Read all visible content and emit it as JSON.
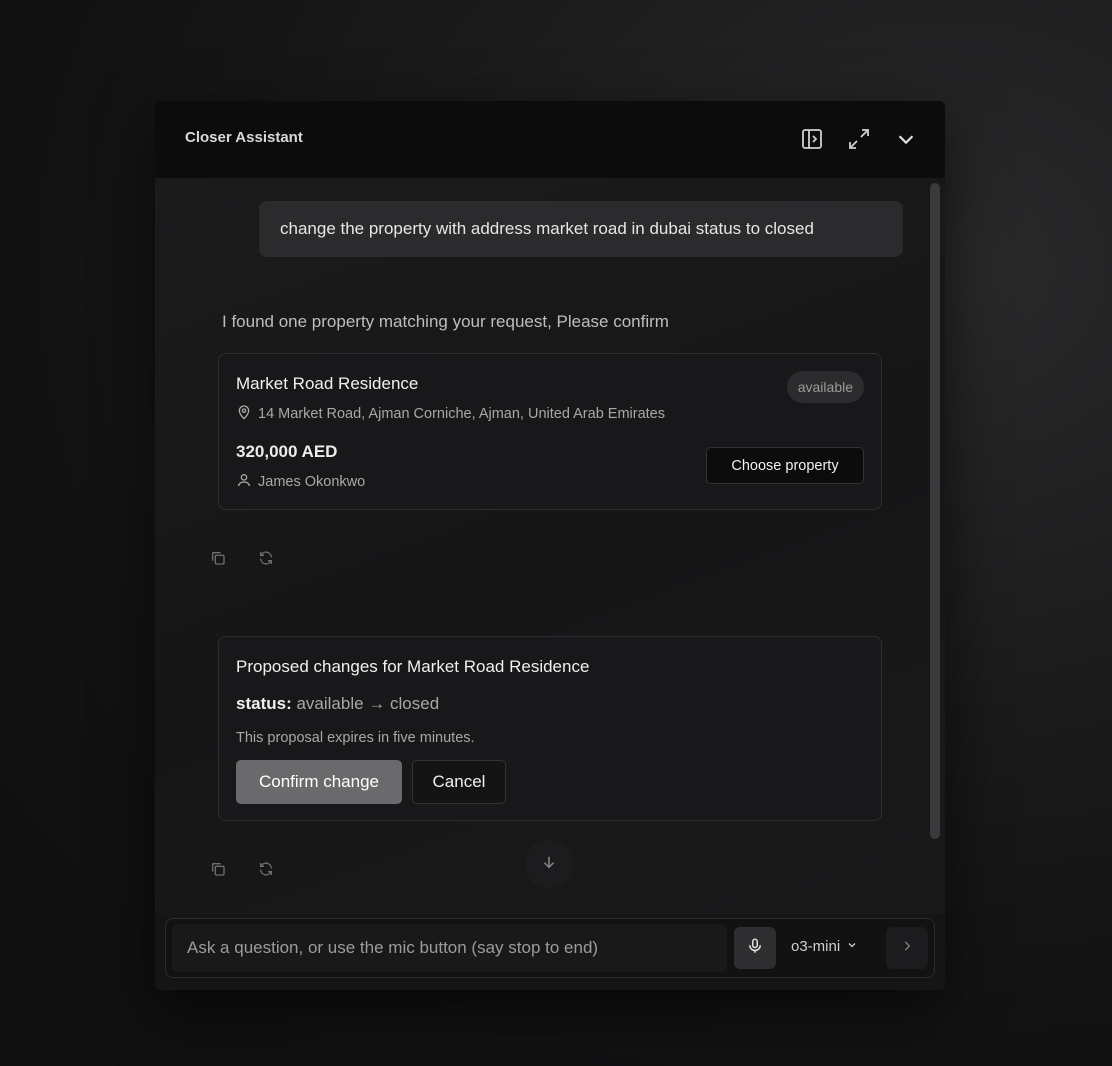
{
  "header": {
    "title": "Closer Assistant"
  },
  "messages": {
    "user": "change the property with address market road in dubai status to closed",
    "assistant": "I found one property matching your request, Please confirm"
  },
  "property_card": {
    "title": "Market Road Residence",
    "status_badge": "available",
    "address": "14 Market Road, Ajman Corniche, Ajman, United Arab Emirates",
    "price": "320,000 AED",
    "owner": "James Okonkwo",
    "choose_label": "Choose property"
  },
  "proposal": {
    "title": "Proposed changes for Market Road Residence",
    "field": "status:",
    "change": "available → closed",
    "expiry": "This proposal expires in five minutes.",
    "confirm_label": "Confirm change",
    "cancel_label": "Cancel"
  },
  "composer": {
    "placeholder": "Ask a question, or use the mic button (say stop to end)",
    "model": "o3-mini"
  },
  "icons": {
    "sidebar": "sidebar-toggle-icon",
    "expand": "expand-icon",
    "collapse": "chevron-down-icon",
    "copy": "copy-icon",
    "regenerate": "refresh-icon",
    "location": "map-pin-icon",
    "user": "user-icon",
    "scroll": "arrow-down-icon",
    "mic": "mic-icon",
    "send": "chevron-right-icon"
  },
  "colors": {
    "background": "#151516",
    "header": "#0c0c0d",
    "confirm_button": "#6a6a6c"
  }
}
